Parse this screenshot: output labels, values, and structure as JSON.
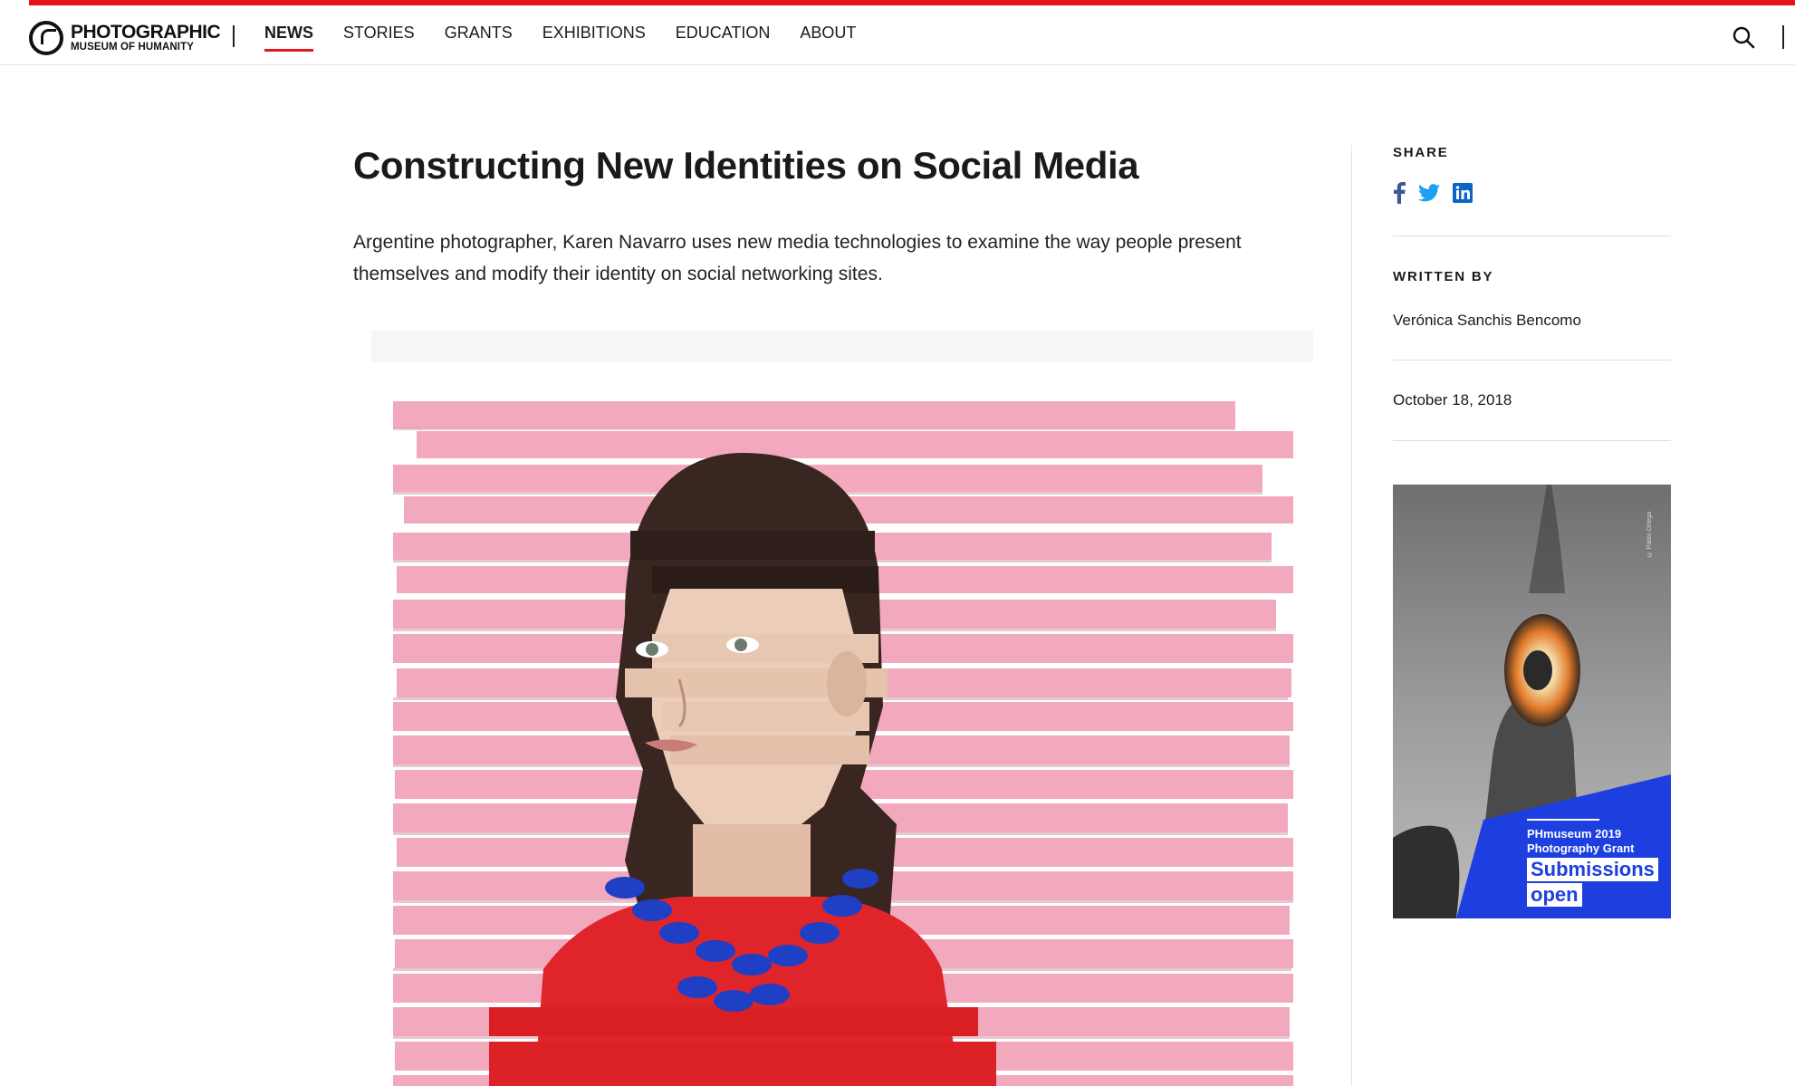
{
  "colors": {
    "brand_red": "#e8141c",
    "text": "#1a1a1a",
    "ad_blue": "#1d3fe0",
    "pink": "#f2a9bd"
  },
  "logo": {
    "line1": "PHOTOGRAPHIC",
    "line2": "MUSEUM OF HUMANITY",
    "icon": "ring-logo-icon"
  },
  "nav": {
    "items": [
      {
        "label": "NEWS",
        "active": true
      },
      {
        "label": "STORIES",
        "active": false
      },
      {
        "label": "GRANTS",
        "active": false
      },
      {
        "label": "EXHIBITIONS",
        "active": false
      },
      {
        "label": "EDUCATION",
        "active": false
      },
      {
        "label": "ABOUT",
        "active": false
      }
    ],
    "search_icon": "search-icon"
  },
  "article": {
    "title": "Constructing New Identities on Social Media",
    "lead": "Argentine photographer, Karen Navarro uses new media technologies to examine the way people present themselves and modify their identity on social networking sites."
  },
  "sidebar": {
    "share_label": "SHARE",
    "share_icons": [
      "facebook-icon",
      "twitter-icon",
      "linkedin-icon"
    ],
    "written_by_label": "WRITTEN BY",
    "author": "Verónica Sanchis Bencomo",
    "date": "October 18, 2018"
  },
  "ad": {
    "title_line1": "PHmuseum 2019",
    "title_line2": "Photography Grant",
    "cta_line1": "Submissions",
    "cta_line2": "open",
    "credit": "© Pablo Ortega"
  }
}
